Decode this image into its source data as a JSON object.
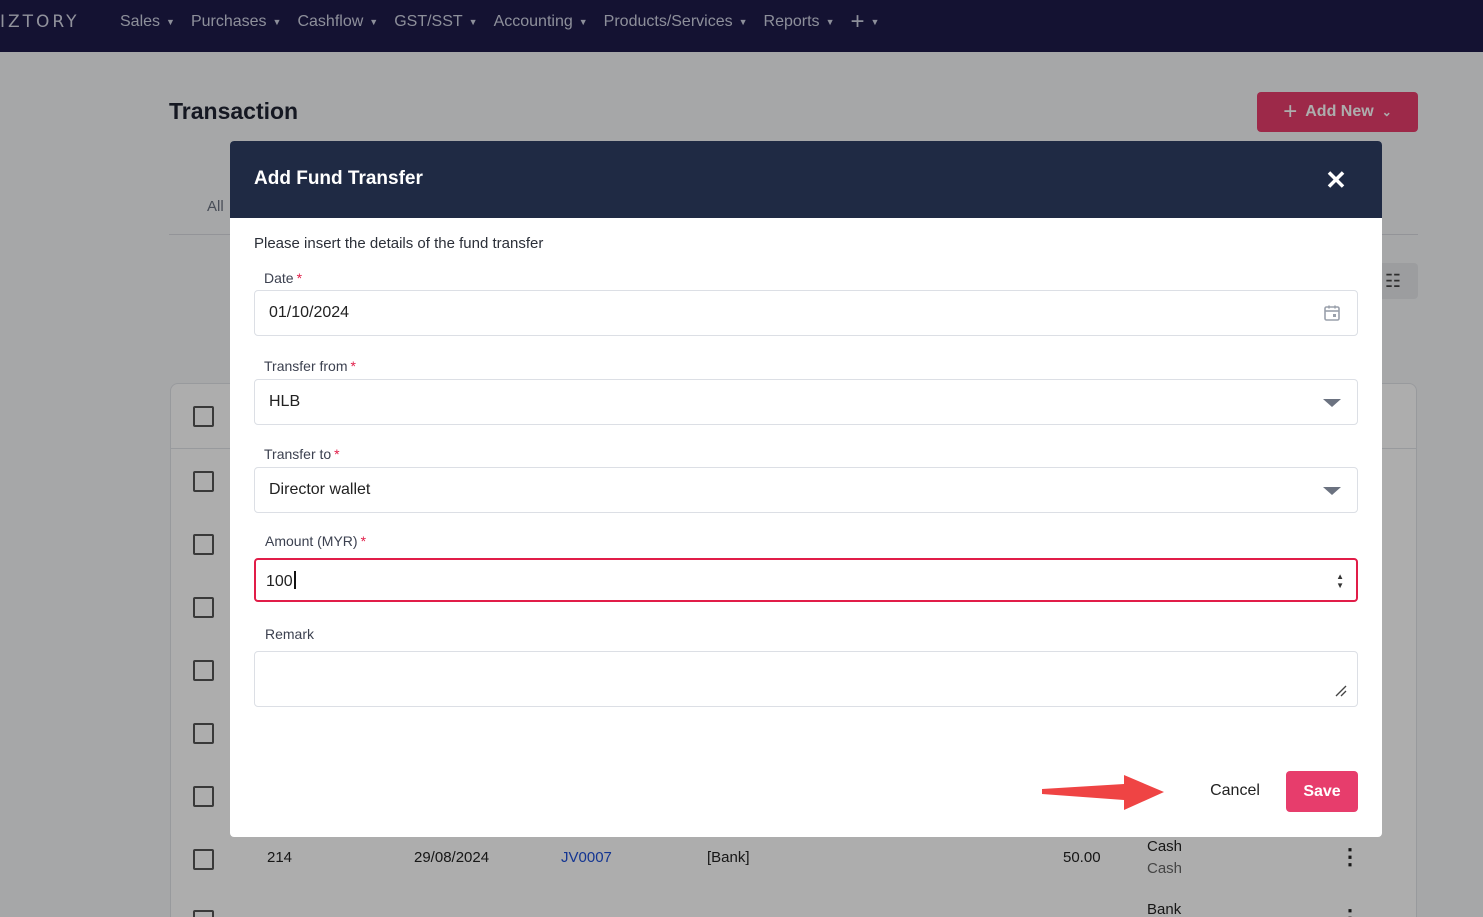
{
  "nav": {
    "brand": "IZTORY",
    "items": [
      {
        "label": "Sales"
      },
      {
        "label": "Purchases"
      },
      {
        "label": "Cashflow"
      },
      {
        "label": "GST/SST"
      },
      {
        "label": "Accounting"
      },
      {
        "label": "Products/Services"
      },
      {
        "label": "Reports"
      }
    ],
    "plus_icon": "plus-icon"
  },
  "page": {
    "title": "Transaction",
    "add_new_label": "Add New",
    "tab_all": "All"
  },
  "rows": [
    {
      "id": "214",
      "date": "29/08/2024",
      "ref": "JV0007",
      "account": "[Bank]",
      "amount": "50.00",
      "type_top": "Cash",
      "type_bottom": "Cash"
    },
    {
      "type_top": "Bank"
    }
  ],
  "modal": {
    "title": "Add Fund Transfer",
    "intro": "Please insert the details of the fund transfer",
    "date_label": "Date",
    "date_value": "01/10/2024",
    "from_label": "Transfer from",
    "from_value": "HLB",
    "to_label": "Transfer to",
    "to_value": "Director wallet",
    "amount_label": "Amount (MYR)",
    "amount_value": "100",
    "remark_label": "Remark",
    "remark_value": "",
    "required_mark": "*",
    "cancel_label": "Cancel",
    "save_label": "Save"
  },
  "colors": {
    "nav_bg": "#1e1b4b",
    "modal_header_bg": "#1f2a44",
    "accent": "#e73d6c",
    "arrow": "#ef4444"
  }
}
